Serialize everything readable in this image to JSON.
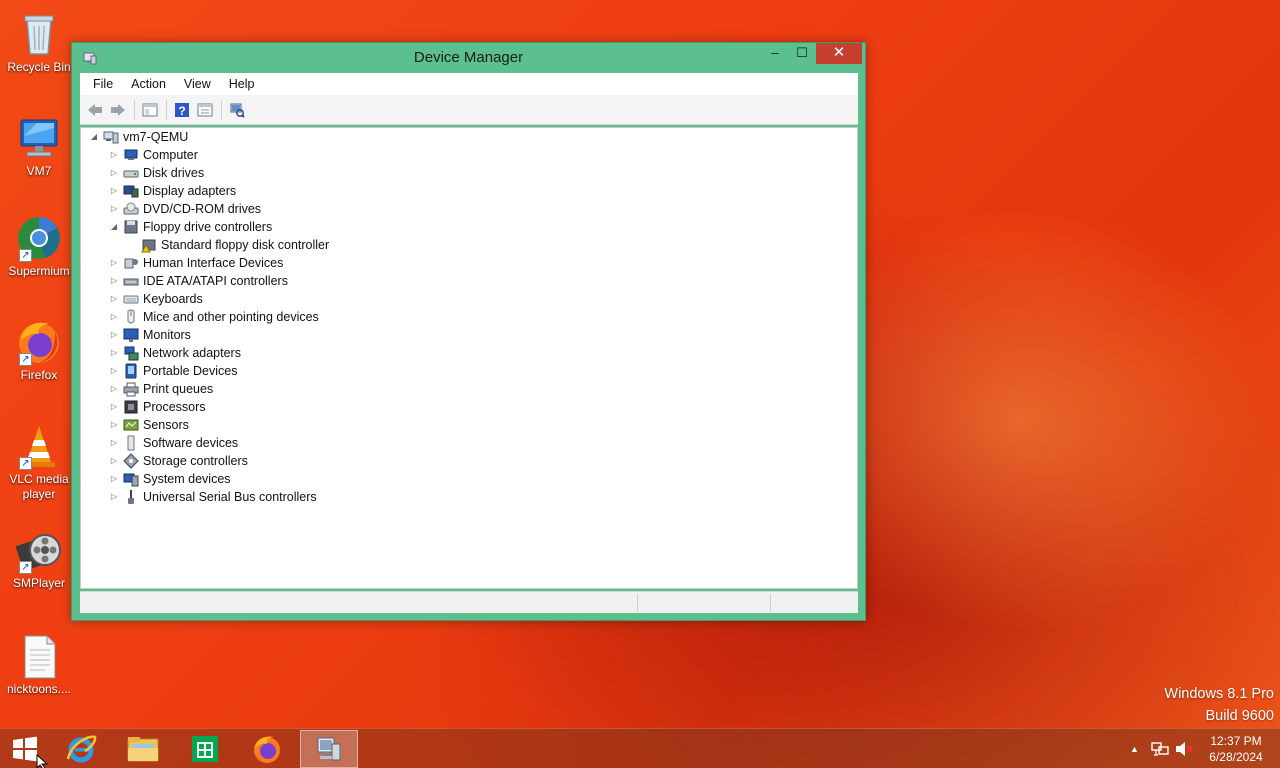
{
  "desktop": {
    "icons": [
      {
        "label": "Recycle Bin"
      },
      {
        "label": "VM7"
      },
      {
        "label": "Supermium"
      },
      {
        "label": "Firefox"
      },
      {
        "label": "VLC media player"
      },
      {
        "label": "SMPlayer"
      },
      {
        "label": "nicktoons...."
      }
    ]
  },
  "window": {
    "title": "Device Manager",
    "controls": {
      "minimize": "–",
      "maximize": "☐",
      "close": "✕"
    },
    "menu": [
      "File",
      "Action",
      "View",
      "Help"
    ],
    "tree": {
      "root": "vm7-QEMU",
      "items": [
        {
          "label": "Computer",
          "icon": "computer-icon"
        },
        {
          "label": "Disk drives",
          "icon": "disk-drive-icon"
        },
        {
          "label": "Display adapters",
          "icon": "display-adapter-icon"
        },
        {
          "label": "DVD/CD-ROM drives",
          "icon": "dvd-drive-icon"
        },
        {
          "label": "Floppy drive controllers",
          "icon": "floppy-controller-icon",
          "expanded": true
        },
        {
          "label": "Standard floppy disk controller",
          "icon": "warning-controller-icon",
          "child": true
        },
        {
          "label": "Human Interface Devices",
          "icon": "hid-icon"
        },
        {
          "label": "IDE ATA/ATAPI controllers",
          "icon": "ide-controller-icon"
        },
        {
          "label": "Keyboards",
          "icon": "keyboard-icon"
        },
        {
          "label": "Mice and other pointing devices",
          "icon": "mouse-icon"
        },
        {
          "label": "Monitors",
          "icon": "monitor-icon"
        },
        {
          "label": "Network adapters",
          "icon": "network-adapter-icon"
        },
        {
          "label": "Portable Devices",
          "icon": "portable-device-icon"
        },
        {
          "label": "Print queues",
          "icon": "printer-icon"
        },
        {
          "label": "Processors",
          "icon": "processor-icon"
        },
        {
          "label": "Sensors",
          "icon": "sensor-icon"
        },
        {
          "label": "Software devices",
          "icon": "software-device-icon"
        },
        {
          "label": "Storage controllers",
          "icon": "storage-controller-icon"
        },
        {
          "label": "System devices",
          "icon": "system-device-icon"
        },
        {
          "label": "Universal Serial Bus controllers",
          "icon": "usb-icon"
        }
      ]
    }
  },
  "watermark": {
    "line1": "Windows 8.1 Pro",
    "line2": "Build 9600"
  },
  "taskbar": {
    "clock": {
      "time": "12:37 PM",
      "date": "6/28/2024"
    },
    "apps": [
      "internet-explorer",
      "file-explorer",
      "store",
      "firefox",
      "device-manager"
    ]
  },
  "colors": {
    "window_frame": "#5bbf8e",
    "close_button": "#c7402f",
    "desktop": "#ef3d12"
  }
}
